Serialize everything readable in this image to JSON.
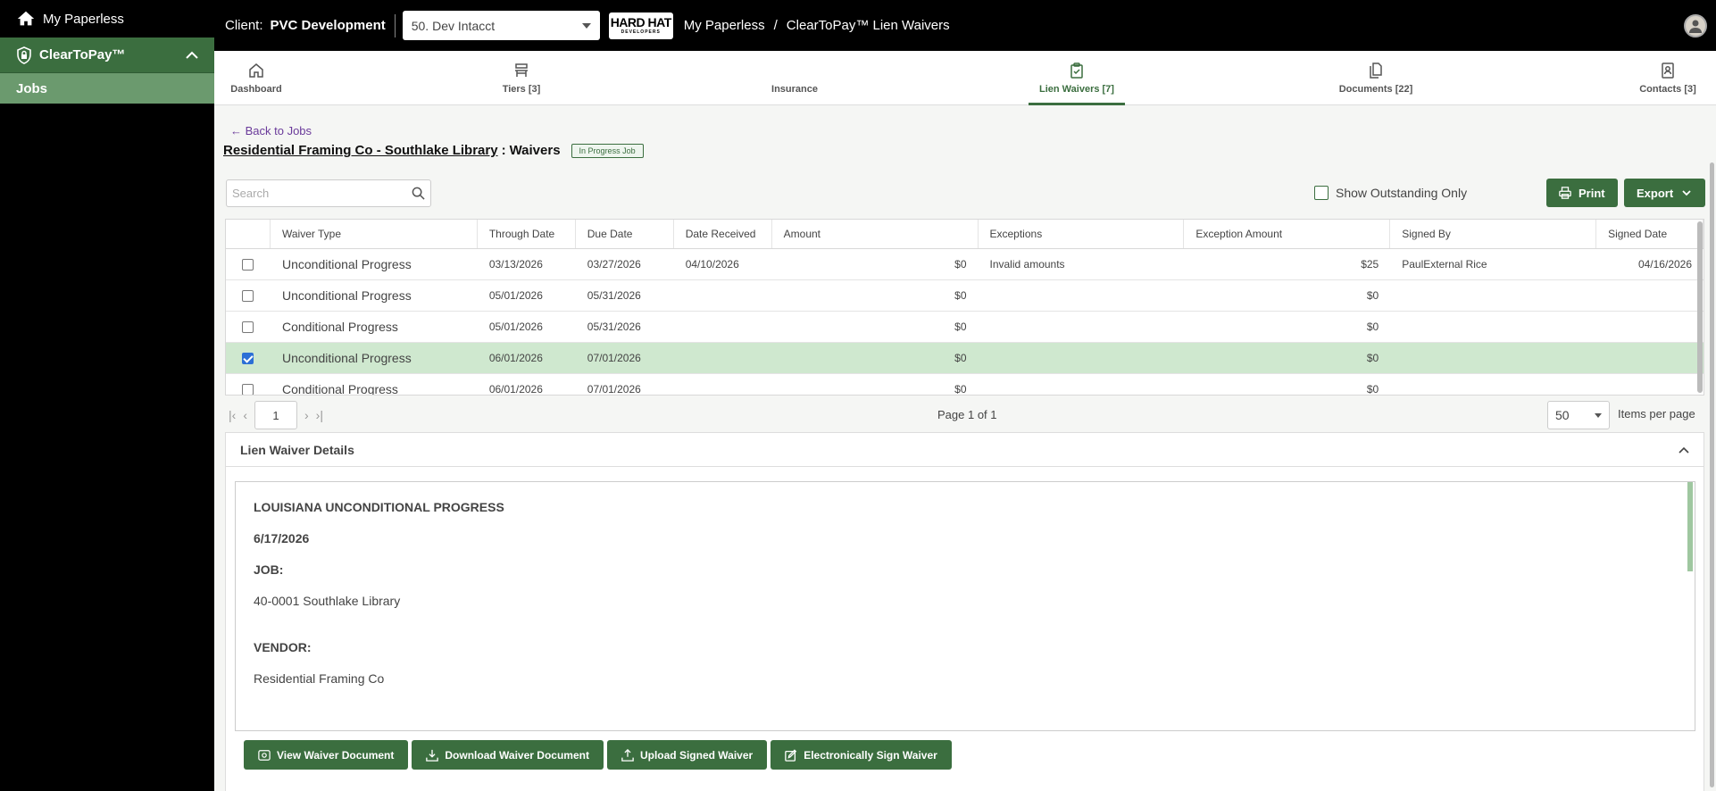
{
  "sidebar": {
    "home_label": "My Paperless",
    "app_label": "ClearToPay™",
    "items": [
      {
        "label": "Jobs"
      }
    ]
  },
  "topbar": {
    "client_label": "Client:",
    "client_name": "PVC Development",
    "client_select": "50. Dev Intacct",
    "logo_text": "HARD HAT",
    "logo_sub": "DEVELOPERS",
    "breadcrumb": [
      "My Paperless",
      "/",
      "ClearToPay™ Lien Waivers"
    ]
  },
  "tabs": [
    {
      "label": "Dashboard",
      "icon": "home-icon"
    },
    {
      "label": "Tiers [3]",
      "icon": "tiers-icon"
    },
    {
      "label": "Insurance",
      "icon": "insurance-icon"
    },
    {
      "label": "Lien Waivers [7]",
      "icon": "clipboard-check-icon",
      "active": true
    },
    {
      "label": "Documents [22]",
      "icon": "documents-icon"
    },
    {
      "label": "Contacts [3]",
      "icon": "contacts-icon"
    }
  ],
  "page": {
    "back_label": "← Back to Jobs",
    "title_link": "Residential Framing Co - Southlake Library",
    "title_sep": ":",
    "title_suffix": "Waivers",
    "status_badge": "In Progress Job"
  },
  "toolbar": {
    "search_placeholder": "Search",
    "outstanding_label": "Show Outstanding Only",
    "print_label": "Print",
    "export_label": "Export"
  },
  "table": {
    "columns": [
      "Waiver Type",
      "Through Date",
      "Due Date",
      "Date Received",
      "Amount",
      "Exceptions",
      "Exception Amount",
      "Signed By",
      "Signed Date"
    ],
    "rows": [
      {
        "checked": false,
        "waiver_type": "Unconditional Progress",
        "through_date": "03/13/2026",
        "due_date": "03/27/2026",
        "date_received": "04/10/2026",
        "amount": "$0",
        "exceptions": "Invalid amounts",
        "exception_amount": "$25",
        "signed_by": "PaulExternal Rice",
        "signed_date": "04/16/2026"
      },
      {
        "checked": false,
        "waiver_type": "Unconditional Progress",
        "through_date": "05/01/2026",
        "due_date": "05/31/2026",
        "date_received": "",
        "amount": "$0",
        "exceptions": "",
        "exception_amount": "$0",
        "signed_by": "",
        "signed_date": ""
      },
      {
        "checked": false,
        "waiver_type": "Conditional Progress",
        "through_date": "05/01/2026",
        "due_date": "05/31/2026",
        "date_received": "",
        "amount": "$0",
        "exceptions": "",
        "exception_amount": "$0",
        "signed_by": "",
        "signed_date": ""
      },
      {
        "checked": true,
        "waiver_type": "Unconditional Progress",
        "through_date": "06/01/2026",
        "due_date": "07/01/2026",
        "date_received": "",
        "amount": "$0",
        "exceptions": "",
        "exception_amount": "$0",
        "signed_by": "",
        "signed_date": ""
      },
      {
        "checked": false,
        "waiver_type": "Conditional Progress",
        "through_date": "06/01/2026",
        "due_date": "07/01/2026",
        "date_received": "",
        "amount": "$0",
        "exceptions": "",
        "exception_amount": "$0",
        "signed_by": "",
        "signed_date": ""
      }
    ]
  },
  "pager": {
    "page": "1",
    "info": "Page 1 of 1",
    "per_page": "50",
    "per_page_label": "Items per page"
  },
  "details": {
    "title": "Lien Waiver Details",
    "doc_title": "LOUISIANA UNCONDITIONAL PROGRESS",
    "doc_date": "6/17/2026",
    "job_label": "JOB:",
    "job_value": "40-0001 Southlake Library",
    "vendor_label": "VENDOR:",
    "vendor_value": "Residential Framing Co",
    "buttons": {
      "view": "View Waiver Document",
      "download": "Download Waiver Document",
      "upload": "Upload Signed Waiver",
      "esign": "Electronically Sign Waiver"
    }
  },
  "colors": {
    "accent": "#3b6e3f",
    "selected_row": "#cfe8cf",
    "sidebar_sub": "#6b9a6e"
  }
}
